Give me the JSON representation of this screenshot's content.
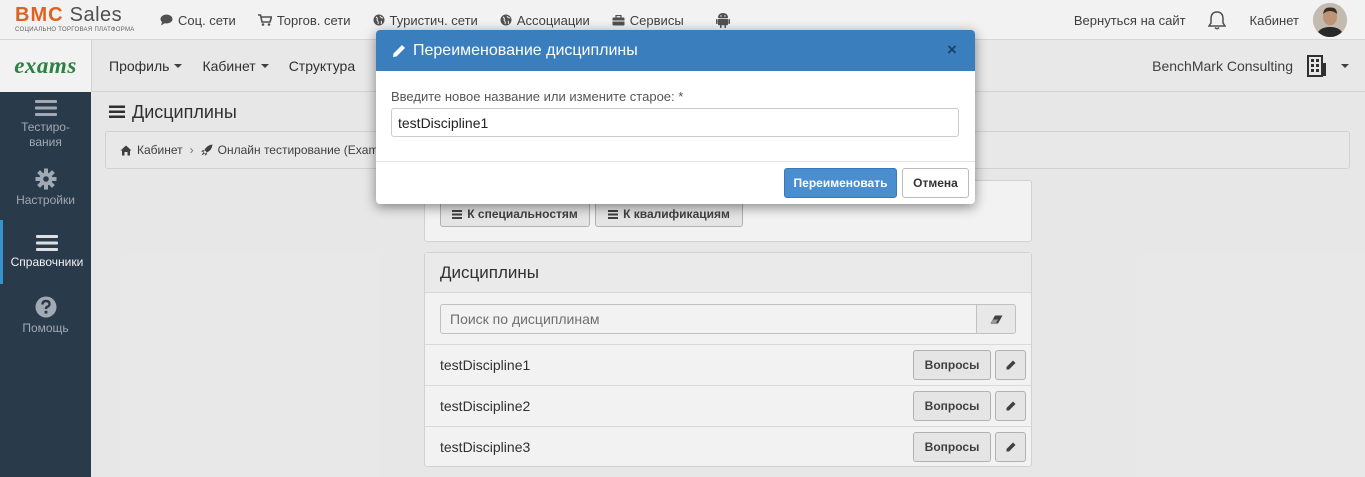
{
  "topbar": {
    "logo_brand_b": "BMC",
    "logo_brand_s": " Sales",
    "logo_tagline": "Социально торговая платформа",
    "nav": [
      {
        "label": "Соц. сети",
        "icon": "comment-icon"
      },
      {
        "label": "Торгов. сети",
        "icon": "cart-icon"
      },
      {
        "label": "Туристич. сети",
        "icon": "globe-icon"
      },
      {
        "label": "Ассоциации",
        "icon": "globe-icon"
      },
      {
        "label": "Сервисы",
        "icon": "briefcase-icon"
      }
    ],
    "back_to_site": "Вернуться на сайт",
    "cabinet": "Кабинет"
  },
  "navbar": {
    "brand": "exams",
    "items": [
      {
        "label": "Профиль"
      },
      {
        "label": "Кабинет"
      },
      {
        "label": "Структура"
      }
    ],
    "org": "BenchMark Consulting"
  },
  "sidebar": {
    "items": [
      {
        "label": "Тестиро-вания",
        "icon": "bars-icon"
      },
      {
        "label": "Настройки",
        "icon": "gear-icon"
      },
      {
        "label": "Справочники",
        "icon": "bars-icon"
      },
      {
        "label": "Помощь",
        "icon": "question-icon"
      }
    ]
  },
  "page": {
    "title": "Дисциплины",
    "breadcrumb": [
      "Кабинет",
      "Онлайн тестирование (Exam"
    ],
    "btn_specialties": "К специальностям",
    "btn_qualifications": "К квалификациям",
    "panel_heading": "Дисциплины",
    "search_placeholder": "Поиск по дисциплинам",
    "questions_label": "Вопросы",
    "disciplines": [
      "testDiscipline1",
      "testDiscipline2",
      "testDiscipline3"
    ]
  },
  "modal": {
    "title": "Переименование дисциплины",
    "close": "×",
    "label": "Введите новое название или измените старое: *",
    "value": "testDiscipline1",
    "rename_button": "Переименовать",
    "cancel_button": "Отмена"
  },
  "colors": {
    "modal_header": "#3a7ebe",
    "sidebar": "#2c3e50",
    "brand_green": "#2e8a47",
    "logo_orange": "#e86a24"
  }
}
